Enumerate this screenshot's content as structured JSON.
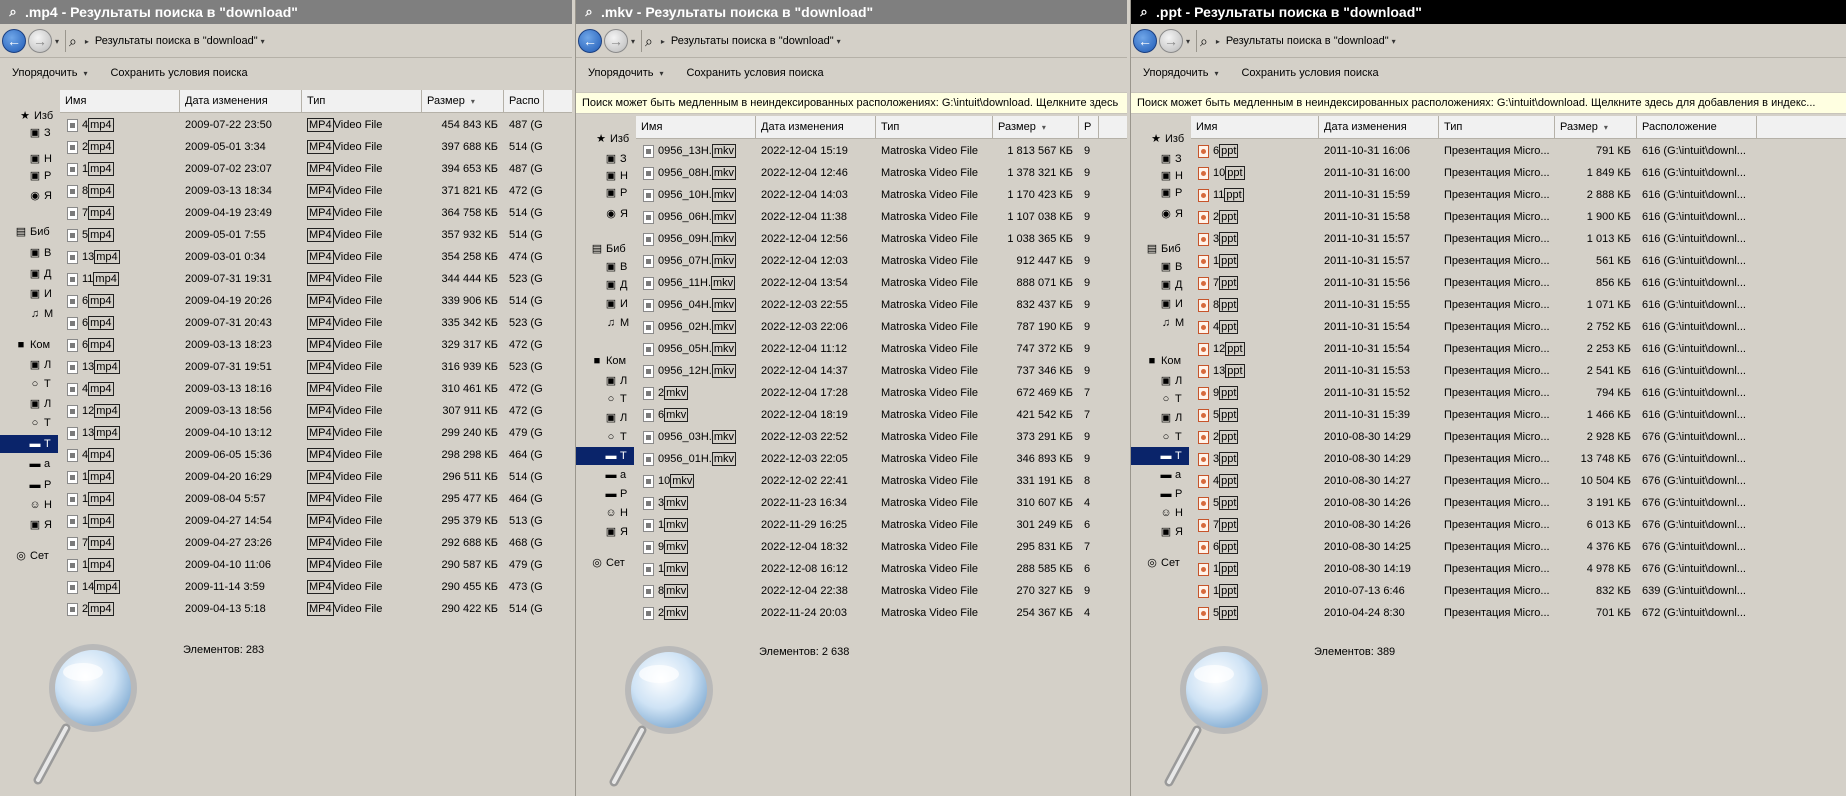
{
  "windows": [
    {
      "id": "mp4",
      "title": ".mp4 - Результаты поиска в \"download\"",
      "address": "Результаты поиска в \"download\"",
      "toolbar": {
        "organize": "Упорядочить",
        "save_search": "Сохранить условия поиска"
      },
      "info": "",
      "columns": [
        "Имя",
        "Дата изменения",
        "Тип",
        "Размер",
        "Распо"
      ],
      "nav": [
        "Изб",
        "З",
        "Н",
        "Р",
        "Я",
        "Биб",
        "В",
        "Д",
        "И",
        "М",
        "Ком",
        "Л",
        "Т",
        "Л",
        "Т",
        "Т",
        "а",
        "Р",
        "Н",
        "Я",
        "Сет"
      ],
      "rows": [
        {
          "name": "4",
          "ext": "mp4",
          "date": "2009-07-22 23:50",
          "type": "Video File",
          "size": "454 843 КБ",
          "loc": "487 (G"
        },
        {
          "name": "2",
          "ext": "mp4",
          "date": "2009-05-01 3:34",
          "type": "Video File",
          "size": "397 688 КБ",
          "loc": "514 (G"
        },
        {
          "name": "1",
          "ext": "mp4",
          "date": "2009-07-02 23:07",
          "type": "Video File",
          "size": "394 653 КБ",
          "loc": "487 (G"
        },
        {
          "name": "8",
          "ext": "mp4",
          "date": "2009-03-13 18:34",
          "type": "Video File",
          "size": "371 821 КБ",
          "loc": "472 (G"
        },
        {
          "name": "7",
          "ext": "mp4",
          "date": "2009-04-19 23:49",
          "type": "Video File",
          "size": "364 758 КБ",
          "loc": "514 (G"
        },
        {
          "name": "5",
          "ext": "mp4",
          "date": "2009-05-01 7:55",
          "type": "Video File",
          "size": "357 932 КБ",
          "loc": "514 (G"
        },
        {
          "name": "13",
          "ext": "mp4",
          "date": "2009-03-01 0:34",
          "type": "Video File",
          "size": "354 258 КБ",
          "loc": "474 (G"
        },
        {
          "name": "11",
          "ext": "mp4",
          "date": "2009-07-31 19:31",
          "type": "Video File",
          "size": "344 444 КБ",
          "loc": "523 (G"
        },
        {
          "name": "6",
          "ext": "mp4",
          "date": "2009-04-19 20:26",
          "type": "Video File",
          "size": "339 906 КБ",
          "loc": "514 (G"
        },
        {
          "name": "6",
          "ext": "mp4",
          "date": "2009-07-31 20:43",
          "type": "Video File",
          "size": "335 342 КБ",
          "loc": "523 (G"
        },
        {
          "name": "6",
          "ext": "mp4",
          "date": "2009-03-13 18:23",
          "type": "Video File",
          "size": "329 317 КБ",
          "loc": "472 (G"
        },
        {
          "name": "13",
          "ext": "mp4",
          "date": "2009-07-31 19:51",
          "type": "Video File",
          "size": "316 939 КБ",
          "loc": "523 (G"
        },
        {
          "name": "4",
          "ext": "mp4",
          "date": "2009-03-13 18:16",
          "type": "Video File",
          "size": "310 461 КБ",
          "loc": "472 (G"
        },
        {
          "name": "12",
          "ext": "mp4",
          "date": "2009-03-13 18:56",
          "type": "Video File",
          "size": "307 911 КБ",
          "loc": "472 (G"
        },
        {
          "name": "13",
          "ext": "mp4",
          "date": "2009-04-10 13:12",
          "type": "Video File",
          "size": "299 240 КБ",
          "loc": "479 (G"
        },
        {
          "name": "4",
          "ext": "mp4",
          "date": "2009-06-05 15:36",
          "type": "Video File",
          "size": "298 298 КБ",
          "loc": "464 (G"
        },
        {
          "name": "1",
          "ext": "mp4",
          "date": "2009-04-20 16:29",
          "type": "Video File",
          "size": "296 511 КБ",
          "loc": "514 (G"
        },
        {
          "name": "1",
          "ext": "mp4",
          "date": "2009-08-04 5:57",
          "type": "Video File",
          "size": "295 477 КБ",
          "loc": "464 (G"
        },
        {
          "name": "1",
          "ext": "mp4",
          "date": "2009-04-27 14:54",
          "type": "Video File",
          "size": "295 379 КБ",
          "loc": "513 (G"
        },
        {
          "name": "7",
          "ext": "mp4",
          "date": "2009-04-27 23:26",
          "type": "Video File",
          "size": "292 688 КБ",
          "loc": "468 (G"
        },
        {
          "name": "1",
          "ext": "mp4",
          "date": "2009-04-10 11:06",
          "type": "Video File",
          "size": "290 587 КБ",
          "loc": "479 (G"
        },
        {
          "name": "14",
          "ext": "mp4",
          "date": "2009-11-14 3:59",
          "type": "Video File",
          "size": "290 455 КБ",
          "loc": "473 (G"
        },
        {
          "name": "2",
          "ext": "mp4",
          "date": "2009-04-13 5:18",
          "type": "Video File",
          "size": "290 422 КБ",
          "loc": "514 (G"
        }
      ],
      "count": "Элементов: 283"
    },
    {
      "id": "mkv",
      "title": ".mkv - Результаты поиска в \"download\"",
      "address": "Результаты поиска в \"download\"",
      "toolbar": {
        "organize": "Упорядочить",
        "save_search": "Сохранить условия поиска"
      },
      "info": "Поиск может быть медленным в неиндексированных расположениях: G:\\intuit\\download. Щелкните здесь",
      "columns": [
        "Имя",
        "Дата изменения",
        "Тип",
        "Размер",
        "Р"
      ],
      "nav": [
        "Изб",
        "З",
        "Н",
        "Р",
        "Я",
        "Биб",
        "В",
        "Д",
        "И",
        "М",
        "Ком",
        "Л",
        "Т",
        "Л",
        "Т",
        "Т",
        "а",
        "Р",
        "Н",
        "Я",
        "Сет"
      ],
      "rows": [
        {
          "name": "0956_13H.",
          "ext": "mkv",
          "date": "2022-12-04 15:19",
          "type": "Matroska Video File",
          "size": "1 813 567 КБ",
          "loc": "9"
        },
        {
          "name": "0956_08H.",
          "ext": "mkv",
          "date": "2022-12-04 12:46",
          "type": "Matroska Video File",
          "size": "1 378 321 КБ",
          "loc": "9"
        },
        {
          "name": "0956_10H.",
          "ext": "mkv",
          "date": "2022-12-04 14:03",
          "type": "Matroska Video File",
          "size": "1 170 423 КБ",
          "loc": "9"
        },
        {
          "name": "0956_06H.",
          "ext": "mkv",
          "date": "2022-12-04 11:38",
          "type": "Matroska Video File",
          "size": "1 107 038 КБ",
          "loc": "9"
        },
        {
          "name": "0956_09H.",
          "ext": "mkv",
          "date": "2022-12-04 12:56",
          "type": "Matroska Video File",
          "size": "1 038 365 КБ",
          "loc": "9"
        },
        {
          "name": "0956_07H.",
          "ext": "mkv",
          "date": "2022-12-04 12:03",
          "type": "Matroska Video File",
          "size": "912 447 КБ",
          "loc": "9"
        },
        {
          "name": "0956_11H.",
          "ext": "mkv",
          "date": "2022-12-04 13:54",
          "type": "Matroska Video File",
          "size": "888 071 КБ",
          "loc": "9"
        },
        {
          "name": "0956_04H.",
          "ext": "mkv",
          "date": "2022-12-03 22:55",
          "type": "Matroska Video File",
          "size": "832 437 КБ",
          "loc": "9"
        },
        {
          "name": "0956_02H.",
          "ext": "mkv",
          "date": "2022-12-03 22:06",
          "type": "Matroska Video File",
          "size": "787 190 КБ",
          "loc": "9"
        },
        {
          "name": "0956_05H.",
          "ext": "mkv",
          "date": "2022-12-04 11:12",
          "type": "Matroska Video File",
          "size": "747 372 КБ",
          "loc": "9"
        },
        {
          "name": "0956_12H.",
          "ext": "mkv",
          "date": "2022-12-04 14:37",
          "type": "Matroska Video File",
          "size": "737 346 КБ",
          "loc": "9"
        },
        {
          "name": "2",
          "ext": "mkv",
          "date": "2022-12-04 17:28",
          "type": "Matroska Video File",
          "size": "672 469 КБ",
          "loc": "7"
        },
        {
          "name": "6",
          "ext": "mkv",
          "date": "2022-12-04 18:19",
          "type": "Matroska Video File",
          "size": "421 542 КБ",
          "loc": "7"
        },
        {
          "name": "0956_03H.",
          "ext": "mkv",
          "date": "2022-12-03 22:52",
          "type": "Matroska Video File",
          "size": "373 291 КБ",
          "loc": "9"
        },
        {
          "name": "0956_01H.",
          "ext": "mkv",
          "date": "2022-12-03 22:05",
          "type": "Matroska Video File",
          "size": "346 893 КБ",
          "loc": "9"
        },
        {
          "name": "10",
          "ext": "mkv",
          "date": "2022-12-02 22:41",
          "type": "Matroska Video File",
          "size": "331 191 КБ",
          "loc": "8"
        },
        {
          "name": "3",
          "ext": "mkv",
          "date": "2022-11-23 16:34",
          "type": "Matroska Video File",
          "size": "310 607 КБ",
          "loc": "4"
        },
        {
          "name": "1",
          "ext": "mkv",
          "date": "2022-11-29 16:25",
          "type": "Matroska Video File",
          "size": "301 249 КБ",
          "loc": "6"
        },
        {
          "name": "9",
          "ext": "mkv",
          "date": "2022-12-04 18:32",
          "type": "Matroska Video File",
          "size": "295 831 КБ",
          "loc": "7"
        },
        {
          "name": "1",
          "ext": "mkv",
          "date": "2022-12-08 16:12",
          "type": "Matroska Video File",
          "size": "288 585 КБ",
          "loc": "6"
        },
        {
          "name": "8",
          "ext": "mkv",
          "date": "2022-12-04 22:38",
          "type": "Matroska Video File",
          "size": "270 327 КБ",
          "loc": "9"
        },
        {
          "name": "2",
          "ext": "mkv",
          "date": "2022-11-24 20:03",
          "type": "Matroska Video File",
          "size": "254 367 КБ",
          "loc": "4"
        }
      ],
      "count": "Элементов: 2 638"
    },
    {
      "id": "ppt",
      "title": ".ppt - Результаты поиска в \"download\"",
      "address": "Результаты поиска в \"download\"",
      "toolbar": {
        "organize": "Упорядочить",
        "save_search": "Сохранить условия поиска"
      },
      "info": "Поиск может быть медленным в неиндексированных расположениях: G:\\intuit\\download. Щелкните здесь для добавления в индекс...",
      "columns": [
        "Имя",
        "Дата изменения",
        "Тип",
        "Размер",
        "Расположение"
      ],
      "nav": [
        "Изб",
        "З",
        "Н",
        "Р",
        "Я",
        "Биб",
        "В",
        "Д",
        "И",
        "М",
        "Ком",
        "Л",
        "Т",
        "Л",
        "Т",
        "Т",
        "а",
        "Р",
        "Н",
        "Я",
        "Сет"
      ],
      "rows": [
        {
          "name": "6",
          "ext": "ppt",
          "date": "2011-10-31 16:06",
          "type": "Презентация Micro...",
          "size": "791 КБ",
          "loc": "616 (G:\\intuit\\downl..."
        },
        {
          "name": "10",
          "ext": "ppt",
          "date": "2011-10-31 16:00",
          "type": "Презентация Micro...",
          "size": "1 849 КБ",
          "loc": "616 (G:\\intuit\\downl..."
        },
        {
          "name": "11",
          "ext": "ppt",
          "date": "2011-10-31 15:59",
          "type": "Презентация Micro...",
          "size": "2 888 КБ",
          "loc": "616 (G:\\intuit\\downl..."
        },
        {
          "name": "2",
          "ext": "ppt",
          "date": "2011-10-31 15:58",
          "type": "Презентация Micro...",
          "size": "1 900 КБ",
          "loc": "616 (G:\\intuit\\downl..."
        },
        {
          "name": "3",
          "ext": "ppt",
          "date": "2011-10-31 15:57",
          "type": "Презентация Micro...",
          "size": "1 013 КБ",
          "loc": "616 (G:\\intuit\\downl..."
        },
        {
          "name": "1",
          "ext": "ppt",
          "date": "2011-10-31 15:57",
          "type": "Презентация Micro...",
          "size": "561 КБ",
          "loc": "616 (G:\\intuit\\downl..."
        },
        {
          "name": "7",
          "ext": "ppt",
          "date": "2011-10-31 15:56",
          "type": "Презентация Micro...",
          "size": "856 КБ",
          "loc": "616 (G:\\intuit\\downl..."
        },
        {
          "name": "8",
          "ext": "ppt",
          "date": "2011-10-31 15:55",
          "type": "Презентация Micro...",
          "size": "1 071 КБ",
          "loc": "616 (G:\\intuit\\downl..."
        },
        {
          "name": "4",
          "ext": "ppt",
          "date": "2011-10-31 15:54",
          "type": "Презентация Micro...",
          "size": "2 752 КБ",
          "loc": "616 (G:\\intuit\\downl..."
        },
        {
          "name": "12",
          "ext": "ppt",
          "date": "2011-10-31 15:54",
          "type": "Презентация Micro...",
          "size": "2 253 КБ",
          "loc": "616 (G:\\intuit\\downl..."
        },
        {
          "name": "13",
          "ext": "ppt",
          "date": "2011-10-31 15:53",
          "type": "Презентация Micro...",
          "size": "2 541 КБ",
          "loc": "616 (G:\\intuit\\downl..."
        },
        {
          "name": "9",
          "ext": "ppt",
          "date": "2011-10-31 15:52",
          "type": "Презентация Micro...",
          "size": "794 КБ",
          "loc": "616 (G:\\intuit\\downl..."
        },
        {
          "name": "5",
          "ext": "ppt",
          "date": "2011-10-31 15:39",
          "type": "Презентация Micro...",
          "size": "1 466 КБ",
          "loc": "616 (G:\\intuit\\downl..."
        },
        {
          "name": "2",
          "ext": "ppt",
          "date": "2010-08-30 14:29",
          "type": "Презентация Micro...",
          "size": "2 928 КБ",
          "loc": "676 (G:\\intuit\\downl..."
        },
        {
          "name": "3",
          "ext": "ppt",
          "date": "2010-08-30 14:29",
          "type": "Презентация Micro...",
          "size": "13 748 КБ",
          "loc": "676 (G:\\intuit\\downl..."
        },
        {
          "name": "4",
          "ext": "ppt",
          "date": "2010-08-30 14:27",
          "type": "Презентация Micro...",
          "size": "10 504 КБ",
          "loc": "676 (G:\\intuit\\downl..."
        },
        {
          "name": "5",
          "ext": "ppt",
          "date": "2010-08-30 14:26",
          "type": "Презентация Micro...",
          "size": "3 191 КБ",
          "loc": "676 (G:\\intuit\\downl..."
        },
        {
          "name": "7",
          "ext": "ppt",
          "date": "2010-08-30 14:26",
          "type": "Презентация Micro...",
          "size": "6 013 КБ",
          "loc": "676 (G:\\intuit\\downl..."
        },
        {
          "name": "6",
          "ext": "ppt",
          "date": "2010-08-30 14:25",
          "type": "Презентация Micro...",
          "size": "4 376 КБ",
          "loc": "676 (G:\\intuit\\downl..."
        },
        {
          "name": "1",
          "ext": "ppt",
          "date": "2010-08-30 14:19",
          "type": "Презентация Micro...",
          "size": "4 978 КБ",
          "loc": "676 (G:\\intuit\\downl..."
        },
        {
          "name": "1",
          "ext": "ppt",
          "date": "2010-07-13 6:46",
          "type": "Презентация Micro...",
          "size": "832 КБ",
          "loc": "639 (G:\\intuit\\downl..."
        },
        {
          "name": "5",
          "ext": "ppt",
          "date": "2010-04-24 8:30",
          "type": "Презентация Micro...",
          "size": "701 КБ",
          "loc": "672 (G:\\intuit\\downl..."
        }
      ],
      "count": "Элементов: 389"
    }
  ],
  "mp4_type_tag": "MP4",
  "icons": {
    "title": "search-icon",
    "back": "back-arrow-icon",
    "forward": "forward-arrow-icon",
    "address": "search-icon",
    "footer": "magnifier-icon",
    "file_video": "video-file-icon",
    "file_ppt": "powerpoint-file-icon"
  },
  "colors": {
    "selection": "#0a246a",
    "info_bg": "#ffffe1",
    "window_bg": "#d4d0c8",
    "title_dark": "#000000",
    "title_grey": "#7f7f7f"
  }
}
